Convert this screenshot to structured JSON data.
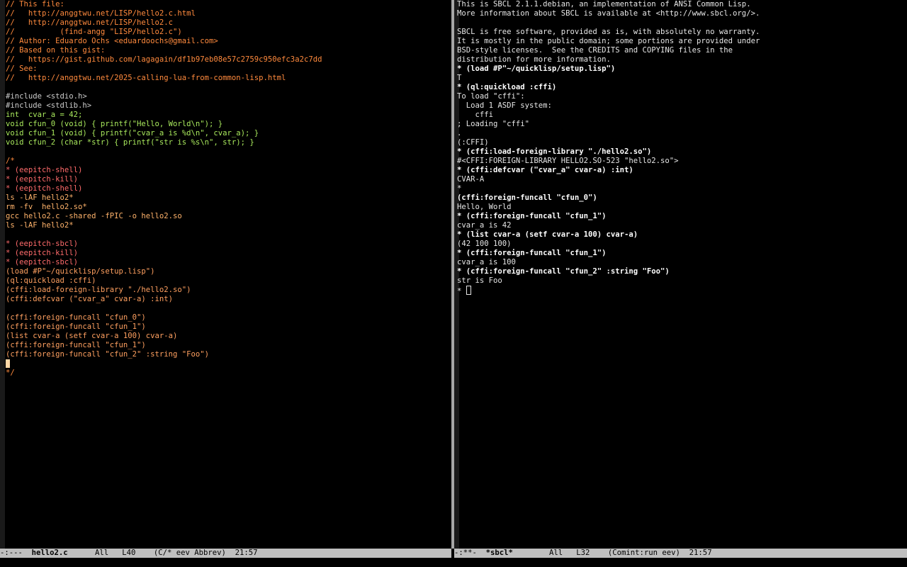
{
  "colors": {
    "comment": "#ff8a3d",
    "include": "#cccccc",
    "code": "#a8e85c",
    "pink": "#ff6b6b",
    "shell": "#ffb36b",
    "sexp": "#ffa060",
    "repl_output": "#e6e6e6",
    "repl_input": "#ffffff"
  },
  "left": {
    "lines": [
      {
        "t": "// This file:",
        "c": "comment"
      },
      {
        "t": "//   http://anggtwu.net/LISP/hello2.c.html",
        "c": "comment"
      },
      {
        "t": "//   http://anggtwu.net/LISP/hello2.c",
        "c": "comment"
      },
      {
        "t": "//          (find-angg \"LISP/hello2.c\")",
        "c": "comment"
      },
      {
        "t": "// Author: Eduardo Ochs <eduardoochs@gmail.com>",
        "c": "comment"
      },
      {
        "t": "// Based on this gist:",
        "c": "comment"
      },
      {
        "t": "//   https://gist.github.com/lagagain/df1b97eb08e57c2759c950efc3a2c7dd",
        "c": "comment"
      },
      {
        "t": "// See:",
        "c": "comment"
      },
      {
        "t": "//   http://anggtwu.net/2025-calling-lua-from-common-lisp.html",
        "c": "comment"
      },
      {
        "t": "",
        "c": "code"
      },
      {
        "t": "#include <stdio.h>",
        "c": "include"
      },
      {
        "t": "#include <stdlib.h>",
        "c": "include"
      },
      {
        "t": "int  cvar_a = 42;",
        "c": "code"
      },
      {
        "t": "void cfun_0 (void) { printf(\"Hello, World\\n\"); }",
        "c": "code"
      },
      {
        "t": "void cfun_1 (void) { printf(\"cvar_a is %d\\n\", cvar_a); }",
        "c": "code"
      },
      {
        "t": "void cfun_2 (char *str) { printf(\"str is %s\\n\", str); }",
        "c": "code"
      },
      {
        "t": "",
        "c": "code"
      },
      {
        "t": "/*",
        "c": "comment"
      },
      {
        "t": "* (eepitch-shell)",
        "c": "pink"
      },
      {
        "t": "* (eepitch-kill)",
        "c": "pink"
      },
      {
        "t": "* (eepitch-shell)",
        "c": "pink"
      },
      {
        "t": "ls -lAF hello2*",
        "c": "shell"
      },
      {
        "t": "rm -fv  hello2.so*",
        "c": "shell"
      },
      {
        "t": "gcc hello2.c -shared -fPIC -o hello2.so",
        "c": "shell"
      },
      {
        "t": "ls -lAF hello2*",
        "c": "shell"
      },
      {
        "t": "",
        "c": "code"
      },
      {
        "t": "* (eepitch-sbcl)",
        "c": "pink"
      },
      {
        "t": "* (eepitch-kill)",
        "c": "pink"
      },
      {
        "t": "* (eepitch-sbcl)",
        "c": "pink"
      },
      {
        "t": "(load #P\"~/quicklisp/setup.lisp\")",
        "c": "sexp"
      },
      {
        "t": "(ql:quickload :cffi)",
        "c": "sexp"
      },
      {
        "t": "(cffi:load-foreign-library \"./hello2.so\")",
        "c": "sexp"
      },
      {
        "t": "(cffi:defcvar (\"cvar_a\" cvar-a) :int)",
        "c": "sexp"
      },
      {
        "t": "",
        "c": "code"
      },
      {
        "t": "(cffi:foreign-funcall \"cfun_0\")",
        "c": "sexp"
      },
      {
        "t": "(cffi:foreign-funcall \"cfun_1\")",
        "c": "sexp"
      },
      {
        "t": "(list cvar-a (setf cvar-a 100) cvar-a)",
        "c": "sexp"
      },
      {
        "t": "(cffi:foreign-funcall \"cfun_1\")",
        "c": "sexp"
      },
      {
        "t": "(cffi:foreign-funcall \"cfun_2\" :string \"Foo\")",
        "c": "sexp"
      },
      {
        "t": "",
        "c": "code",
        "cursor": true
      },
      {
        "t": "*/",
        "c": "comment"
      }
    ],
    "modeline": {
      "status": "-:---  ",
      "buffer": "hello2.c",
      "rest": "      All   L40    (C/* eev Abbrev)  21:57"
    }
  },
  "right": {
    "lines": [
      {
        "t": "This is SBCL 2.1.1.debian, an implementation of ANSI Common Lisp.",
        "c": "repl_output"
      },
      {
        "t": "More information about SBCL is available at <http://www.sbcl.org/>.",
        "c": "repl_output"
      },
      {
        "t": "",
        "c": "repl_output"
      },
      {
        "t": "SBCL is free software, provided as is, with absolutely no warranty.",
        "c": "repl_output"
      },
      {
        "t": "It is mostly in the public domain; some portions are provided under",
        "c": "repl_output"
      },
      {
        "t": "BSD-style licenses.  See the CREDITS and COPYING files in the",
        "c": "repl_output"
      },
      {
        "t": "distribution for more information.",
        "c": "repl_output"
      },
      {
        "t": "* (load #P\"~/quicklisp/setup.lisp\")",
        "c": "repl_input",
        "b": true
      },
      {
        "t": "T",
        "c": "repl_output"
      },
      {
        "t": "* (ql:quickload :cffi)",
        "c": "repl_input",
        "b": true
      },
      {
        "t": "To load \"cffi\":",
        "c": "repl_output"
      },
      {
        "t": "  Load 1 ASDF system:",
        "c": "repl_output"
      },
      {
        "t": "    cffi",
        "c": "repl_output"
      },
      {
        "t": "; Loading \"cffi\"",
        "c": "repl_output"
      },
      {
        "t": ".",
        "c": "repl_output"
      },
      {
        "t": "(:CFFI)",
        "c": "repl_output"
      },
      {
        "t": "* (cffi:load-foreign-library \"./hello2.so\")",
        "c": "repl_input",
        "b": true
      },
      {
        "t": "#<CFFI:FOREIGN-LIBRARY HELLO2.SO-523 \"hello2.so\">",
        "c": "repl_output"
      },
      {
        "t": "* (cffi:defcvar (\"cvar_a\" cvar-a) :int)",
        "c": "repl_input",
        "b": true
      },
      {
        "t": "CVAR-A",
        "c": "repl_output"
      },
      {
        "t": "*",
        "c": "repl_output"
      },
      {
        "t": "(cffi:foreign-funcall \"cfun_0\")",
        "c": "repl_input",
        "b": true
      },
      {
        "t": "Hello, World",
        "c": "repl_output"
      },
      {
        "t": "* (cffi:foreign-funcall \"cfun_1\")",
        "c": "repl_input",
        "b": true
      },
      {
        "t": "cvar_a is 42",
        "c": "repl_output"
      },
      {
        "t": "* (list cvar-a (setf cvar-a 100) cvar-a)",
        "c": "repl_input",
        "b": true
      },
      {
        "t": "(42 100 100)",
        "c": "repl_output"
      },
      {
        "t": "* (cffi:foreign-funcall \"cfun_1\")",
        "c": "repl_input",
        "b": true
      },
      {
        "t": "cvar_a is 100",
        "c": "repl_output"
      },
      {
        "t": "* (cffi:foreign-funcall \"cfun_2\" :string \"Foo\")",
        "c": "repl_input",
        "b": true
      },
      {
        "t": "str is Foo",
        "c": "repl_output"
      },
      {
        "t": "* ",
        "c": "repl_output",
        "box": true
      }
    ],
    "modeline": {
      "status": "-:**-  ",
      "buffer": "*sbcl*",
      "rest": "        All   L32    (Comint:run eev)  21:57"
    }
  }
}
